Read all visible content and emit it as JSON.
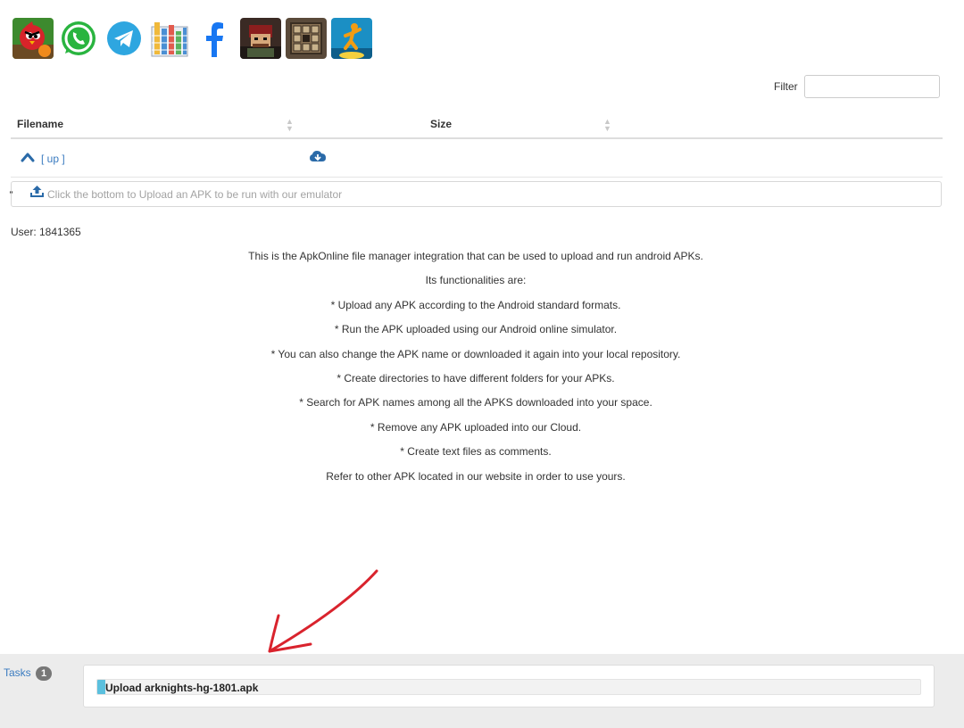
{
  "app_icons": [
    {
      "name": "angry-birds-icon"
    },
    {
      "name": "whatsapp-icon"
    },
    {
      "name": "telegram-icon"
    },
    {
      "name": "spreadsheet-icon"
    },
    {
      "name": "facebook-icon"
    },
    {
      "name": "game-character-icon"
    },
    {
      "name": "puzzle-game-icon"
    },
    {
      "name": "jumping-game-icon"
    }
  ],
  "filter": {
    "label": "Filter",
    "value": "",
    "placeholder": ""
  },
  "table": {
    "columns": [
      {
        "label": "Filename"
      },
      {
        "label": "Size"
      }
    ],
    "up_label": "[ up ]"
  },
  "upload": {
    "text": "Click the bottom to Upload an APK to be run with our emulator"
  },
  "user_line": "User: 1841365",
  "description": [
    "This is the ApkOnline file manager integration that can be used to upload and run android APKs.",
    "Its functionalities are:",
    "* Upload any APK according to the Android standard formats.",
    "* Run the APK uploaded using our Android online simulator.",
    "* You can also change the APK name or downloaded it again into your local repository.",
    "* Create directories to have different folders for your APKs.",
    "* Search for APK names among all the APKS downloaded into your space.",
    "* Remove any APK uploaded into our Cloud.",
    "* Create text files as comments.",
    "Refer to other APK located in our website in order to use yours."
  ],
  "tasks": {
    "label": "Tasks",
    "count": "1",
    "items": [
      {
        "label": "Upload arknights-hg-1801.apk",
        "progress": 0.01
      }
    ]
  },
  "colors": {
    "link": "#3a7bc0",
    "progress": "#5bc0de",
    "annotation_arrow": "#d9232d"
  }
}
